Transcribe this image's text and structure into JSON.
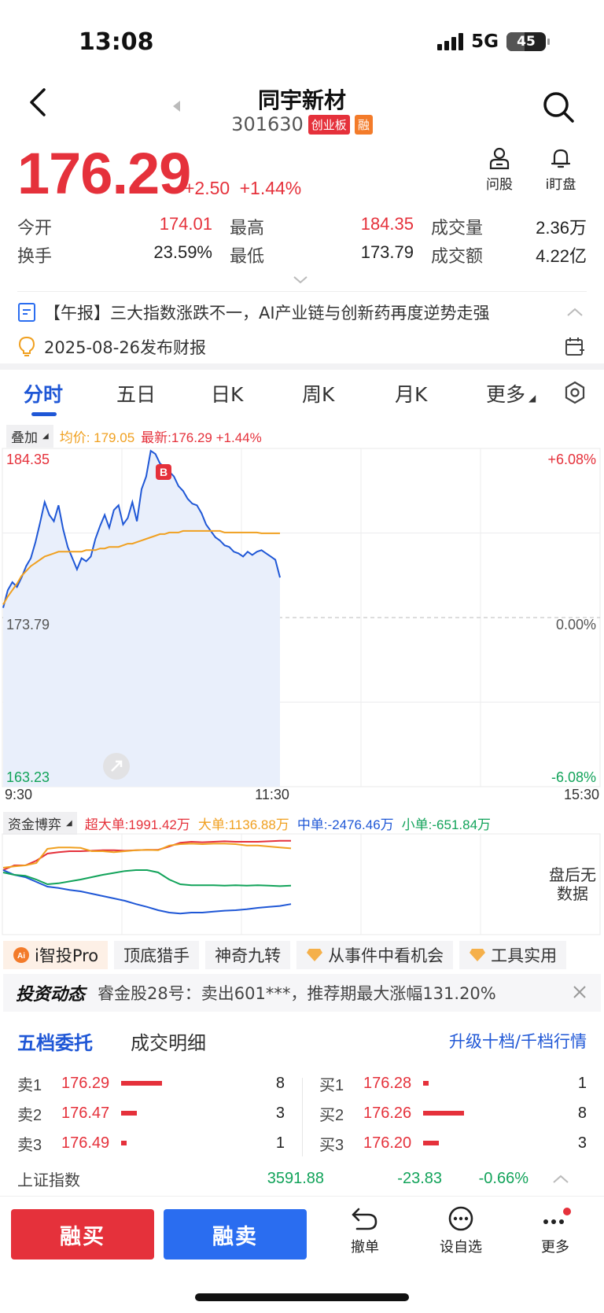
{
  "status": {
    "time": "13:08",
    "network": "5G",
    "battery": "45"
  },
  "header": {
    "name": "同宇新材",
    "code": "301630",
    "board_tag": "创业板",
    "margin_tag": "融"
  },
  "quote": {
    "price": "176.29",
    "change": "+2.50",
    "change_pct": "+1.44%",
    "actions": {
      "ask": "问股",
      "watch": "i盯盘"
    },
    "stats": {
      "open_label": "今开",
      "open": "174.01",
      "high_label": "最高",
      "high": "184.35",
      "vol_label": "成交量",
      "vol": "2.36万",
      "turnover_label": "换手",
      "turnover": "23.59%",
      "low_label": "最低",
      "low": "173.79",
      "amount_label": "成交额",
      "amount": "4.22亿"
    }
  },
  "news": {
    "headline": "【午报】三大指数涨跌不一，AI产业链与创新药再度逆势走强",
    "report": "2025-08-26发布财报"
  },
  "chart_tabs": [
    "分时",
    "五日",
    "日K",
    "周K",
    "月K",
    "更多"
  ],
  "overlay": {
    "chip": "叠加",
    "avg_label": "均价: 179.05",
    "latest_label": "最新:176.29 +1.44%"
  },
  "chart_data": {
    "type": "line",
    "y_left_labels": [
      "184.35",
      "173.79",
      "163.23"
    ],
    "y_right_labels": [
      "+6.08%",
      "0.00%",
      "-6.08%"
    ],
    "x_labels": [
      "9:30",
      "11:30",
      "15:30"
    ],
    "ylim": [
      163.23,
      184.35
    ],
    "prev_close": 173.79,
    "series": [
      {
        "name": "最新",
        "color": "#1f57d6",
        "values": [
          174.4,
          175.5,
          176.0,
          175.7,
          176.3,
          177.0,
          177.5,
          178.5,
          179.7,
          181.0,
          180.2,
          179.8,
          180.8,
          179.3,
          178.2,
          177.5,
          176.8,
          177.5,
          177.3,
          177.6,
          178.7,
          179.5,
          180.2,
          179.4,
          180.5,
          180.8,
          179.6,
          180.0,
          181.0,
          179.8,
          181.8,
          182.6,
          184.2,
          184.0,
          183.4,
          183.2,
          182.9,
          182.6,
          182.0,
          181.7,
          181.2,
          180.9,
          180.8,
          180.3,
          179.6,
          179.2,
          178.8,
          178.6,
          178.3,
          178.2,
          177.9,
          177.8,
          177.6,
          177.9,
          177.7,
          177.9,
          178.0,
          177.8,
          177.6,
          177.4,
          176.29
        ]
      },
      {
        "name": "均价",
        "color": "#f0a020",
        "values": [
          174.6,
          175.1,
          175.5,
          175.9,
          176.4,
          176.7,
          177.0,
          177.2,
          177.4,
          177.6,
          177.7,
          177.8,
          177.9,
          177.9,
          177.9,
          177.9,
          177.9,
          177.9,
          178.0,
          178.0,
          178.0,
          178.1,
          178.1,
          178.2,
          178.2,
          178.2,
          178.3,
          178.4,
          178.4,
          178.5,
          178.6,
          178.7,
          178.8,
          178.9,
          179.0,
          179.0,
          179.1,
          179.1,
          179.1,
          179.2,
          179.2,
          179.2,
          179.2,
          179.2,
          179.2,
          179.2,
          179.2,
          179.2,
          179.1,
          179.1,
          179.1,
          179.1,
          179.1,
          179.1,
          179.1,
          179.1,
          179.05,
          179.05,
          179.05,
          179.05,
          179.05
        ]
      }
    ],
    "annotation": "B"
  },
  "fund_flow": {
    "chip": "资金博弈",
    "super_large": "超大单:1991.42万",
    "large": "大单:1136.88万",
    "medium": "中单:-2476.46万",
    "small": "小单:-651.84万",
    "no_data": "盘后无数据",
    "chart_data": {
      "type": "line",
      "series": [
        {
          "name": "超大单",
          "color": "#e5313b",
          "values": [
            0.3,
            0.4,
            0.4,
            0.5,
            0.65,
            0.68,
            0.7,
            0.7,
            0.71,
            0.72,
            0.72,
            0.71,
            0.72,
            0.73,
            0.73,
            0.8,
            0.88,
            0.9,
            0.89,
            0.9,
            0.91,
            0.9,
            0.9,
            0.9,
            0.91,
            0.92,
            0.92
          ]
        },
        {
          "name": "大单",
          "color": "#f0a020",
          "values": [
            0.35,
            0.38,
            0.4,
            0.45,
            0.75,
            0.78,
            0.78,
            0.77,
            0.7,
            0.7,
            0.68,
            0.7,
            0.72,
            0.73,
            0.72,
            0.82,
            0.85,
            0.86,
            0.85,
            0.86,
            0.86,
            0.85,
            0.82,
            0.82,
            0.8,
            0.78,
            0.76
          ]
        },
        {
          "name": "中单",
          "color": "#1f57d6",
          "values": [
            0.3,
            0.2,
            0.15,
            0.05,
            -0.05,
            -0.08,
            -0.12,
            -0.15,
            -0.2,
            -0.25,
            -0.3,
            -0.35,
            -0.42,
            -0.48,
            -0.55,
            -0.6,
            -0.62,
            -0.6,
            -0.6,
            -0.58,
            -0.56,
            -0.55,
            -0.53,
            -0.5,
            -0.48,
            -0.46,
            -0.42
          ]
        },
        {
          "name": "小单",
          "color": "#12a35a",
          "values": [
            0.25,
            0.2,
            0.18,
            0.1,
            0.0,
            0.02,
            0.06,
            0.1,
            0.15,
            0.2,
            0.24,
            0.28,
            0.3,
            0.3,
            0.25,
            0.1,
            0.0,
            -0.02,
            -0.02,
            -0.02,
            -0.03,
            -0.02,
            -0.03,
            -0.02,
            -0.03,
            -0.04,
            -0.03
          ]
        }
      ]
    }
  },
  "tool_chips": [
    "i智投Pro",
    "顶底猎手",
    "神奇九转",
    "从事件中看机会",
    "工具实用"
  ],
  "invest": {
    "title": "投资动态",
    "text": "睿金股28号：卖出601***，推荐期最大涨幅131.20%"
  },
  "order_book": {
    "tabs": [
      "五档委托",
      "成交明细"
    ],
    "upgrade": "升级十档/千档行情",
    "sell": [
      {
        "label": "卖1",
        "price": "176.29",
        "vol": "8",
        "level": 8
      },
      {
        "label": "卖2",
        "price": "176.47",
        "vol": "3",
        "level": 3
      },
      {
        "label": "卖3",
        "price": "176.49",
        "vol": "1",
        "level": 1
      }
    ],
    "buy": [
      {
        "label": "买1",
        "price": "176.28",
        "vol": "1",
        "level": 1
      },
      {
        "label": "买2",
        "price": "176.26",
        "vol": "8",
        "level": 8
      },
      {
        "label": "买3",
        "price": "176.20",
        "vol": "3",
        "level": 3
      }
    ]
  },
  "index": {
    "name": "上证指数",
    "value": "3591.88",
    "change": "-23.83",
    "pct": "-0.66%"
  },
  "bottom": {
    "buy": "融买",
    "sell": "融卖",
    "cancel": "撤单",
    "watchlist": "设自选",
    "more": "更多"
  },
  "colors": {
    "up": "#e5313b",
    "down": "#12a35a",
    "accent": "#1f57d6",
    "sell_btn": "#2a6df0"
  }
}
